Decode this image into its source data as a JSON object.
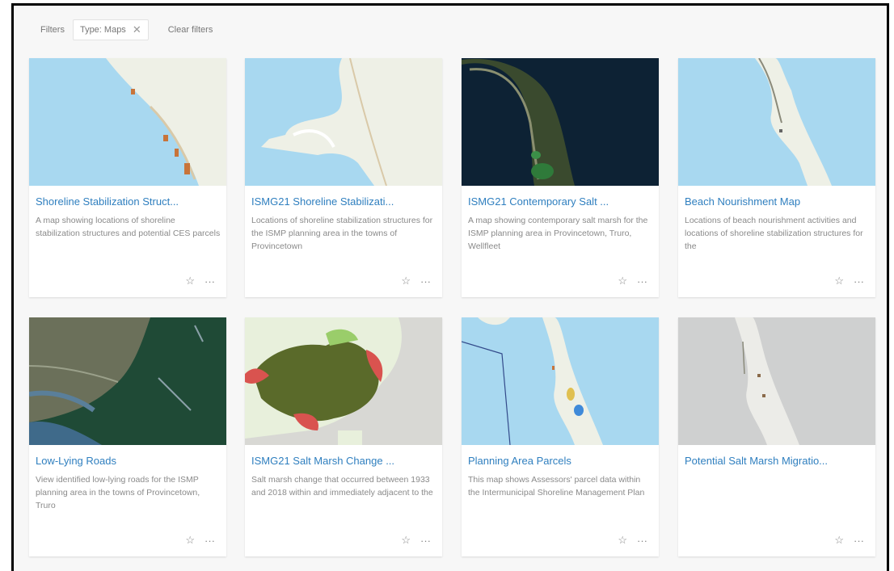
{
  "filters": {
    "label": "Filters",
    "chip_label": "Type: Maps",
    "chip_close": "✕",
    "clear_label": "Clear filters"
  },
  "icons": {
    "favorite": "☆",
    "more": "···"
  },
  "cards": [
    {
      "title": "Shoreline Stabilization Struct...",
      "snippet": "A map showing locations of shoreline stabilization structures and potential CES parcels"
    },
    {
      "title": "ISMG21 Shoreline Stabilizati...",
      "snippet": "Locations of shoreline stabilization structures for the ISMP planning area in the towns of Provincetown"
    },
    {
      "title": "ISMG21 Contemporary Salt ...",
      "snippet": "A map showing contemporary salt marsh for the ISMP planning area in Provincetown, Truro, Wellfleet"
    },
    {
      "title": "Beach Nourishment Map",
      "snippet": "Locations of beach nourishment activities and locations of shoreline stabilization structures for the"
    },
    {
      "title": "Low-Lying Roads",
      "snippet": "View identified low-lying roads for the ISMP planning area in the towns of Provincetown, Truro"
    },
    {
      "title": "ISMG21 Salt Marsh Change ...",
      "snippet": "Salt marsh change that occurred between 1933 and 2018 within and immediately adjacent to the"
    },
    {
      "title": "Planning Area Parcels",
      "snippet": "This map shows Assessors' parcel data within the Intermunicipal Shoreline Management Plan"
    },
    {
      "title": "Potential Salt Marsh Migratio...",
      "snippet": ""
    }
  ]
}
